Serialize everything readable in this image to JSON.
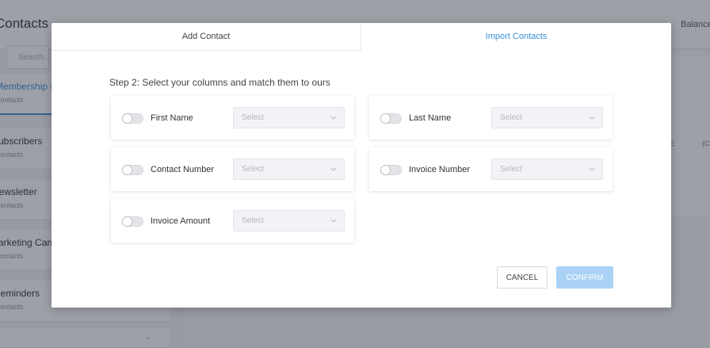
{
  "background": {
    "title": "Contacts",
    "balance": "Balance",
    "search_placeholder": "Search...",
    "sidebar_items": [
      {
        "name": "Membership P",
        "count": "Contacts"
      },
      {
        "name": "Subscribers",
        "count": "Contacts"
      },
      {
        "name": "Newsletter",
        "count": "Contacts"
      },
      {
        "name": "Marketing Can",
        "count": "Contacts"
      },
      {
        "name": "Reminders",
        "count": "Contacts"
      }
    ],
    "col_a": "E",
    "col_b": "(C"
  },
  "modal": {
    "tabs": {
      "add": "Add Contact",
      "import": "Import Contacts"
    },
    "step_title": "Step 2: Select your columns and match them to ours",
    "fields": [
      {
        "label": "First Name",
        "placeholder": "Select"
      },
      {
        "label": "Last Name",
        "placeholder": "Select"
      },
      {
        "label": "Contact Number",
        "placeholder": "Select"
      },
      {
        "label": "Invoice Number",
        "placeholder": "Select"
      },
      {
        "label": "Invoice Amount",
        "placeholder": "Select"
      }
    ],
    "buttons": {
      "cancel": "CANCEL",
      "confirm": "CONFIRM"
    }
  },
  "colors": {
    "accent": "#3a8fd8",
    "confirm_disabled": "#a9d2f4"
  }
}
